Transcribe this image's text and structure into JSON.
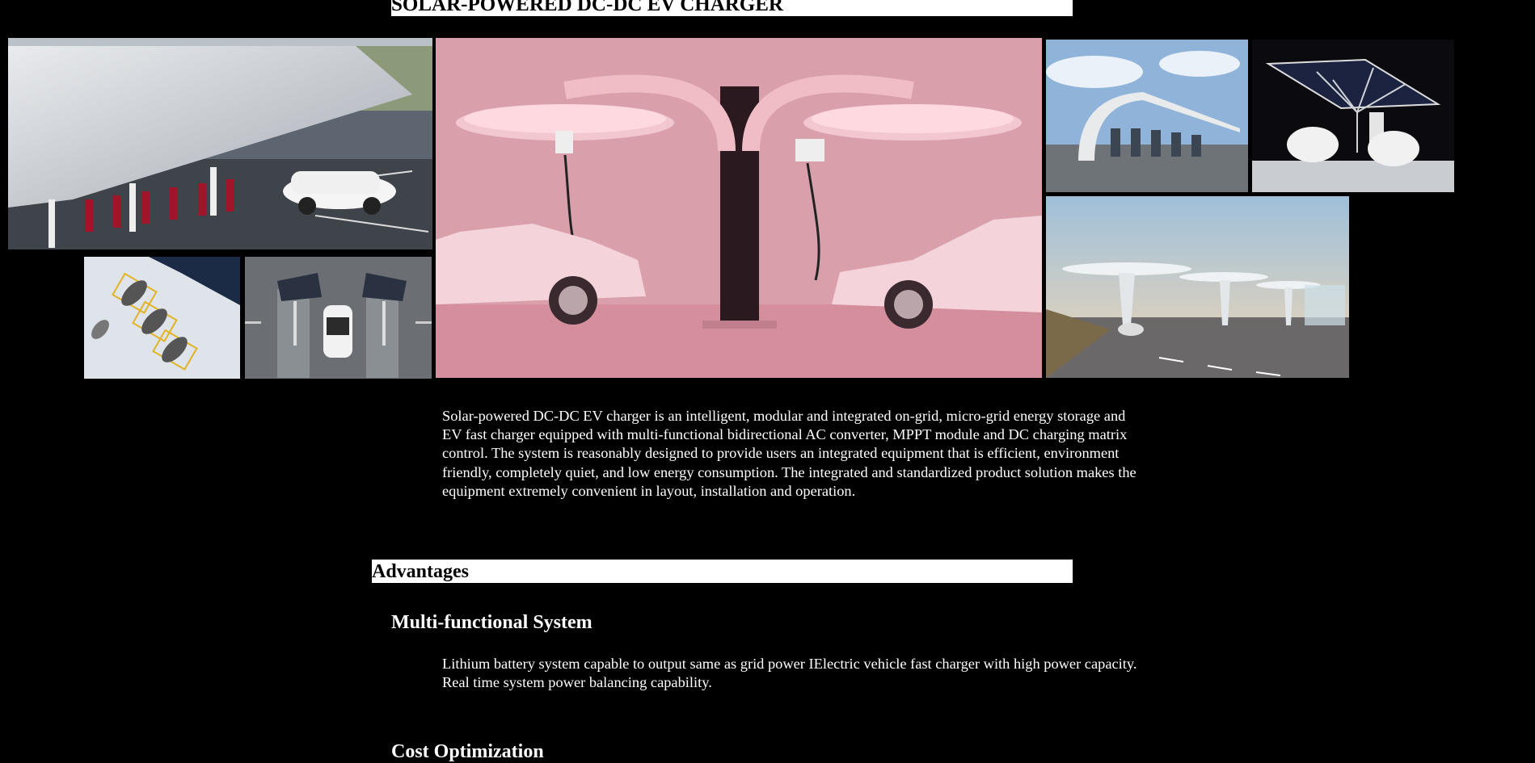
{
  "page": {
    "title": "SOLAR-POWERED DC-DC EV CHARGER",
    "intro": "Solar-powered DC-DC EV charger is an intelligent, modular and integrated on-grid, micro-grid energy storage and EV fast charger equipped with multi-functional bidirectional AC converter, MPPT module and DC charging matrix control. The system is reasonably designed to provide users an integrated equipment that is efficient, environment friendly, completely quiet, and low energy consumption. The integrated and standardized product solution makes the equipment extremely convenient in layout, installation and operation.",
    "advantages_heading": "Advantages",
    "sections": [
      {
        "heading": "Multi-functional System",
        "text": "Lithium battery system capable to output same as grid power IElectric vehicle fast charger with high power capacity. Real time system power balancing capability."
      },
      {
        "heading": "Cost Optimization"
      }
    ]
  },
  "colors": {
    "background": "#000000",
    "heading_bar": "#ffffff",
    "pink_backdrop": "#d9a0ac"
  }
}
